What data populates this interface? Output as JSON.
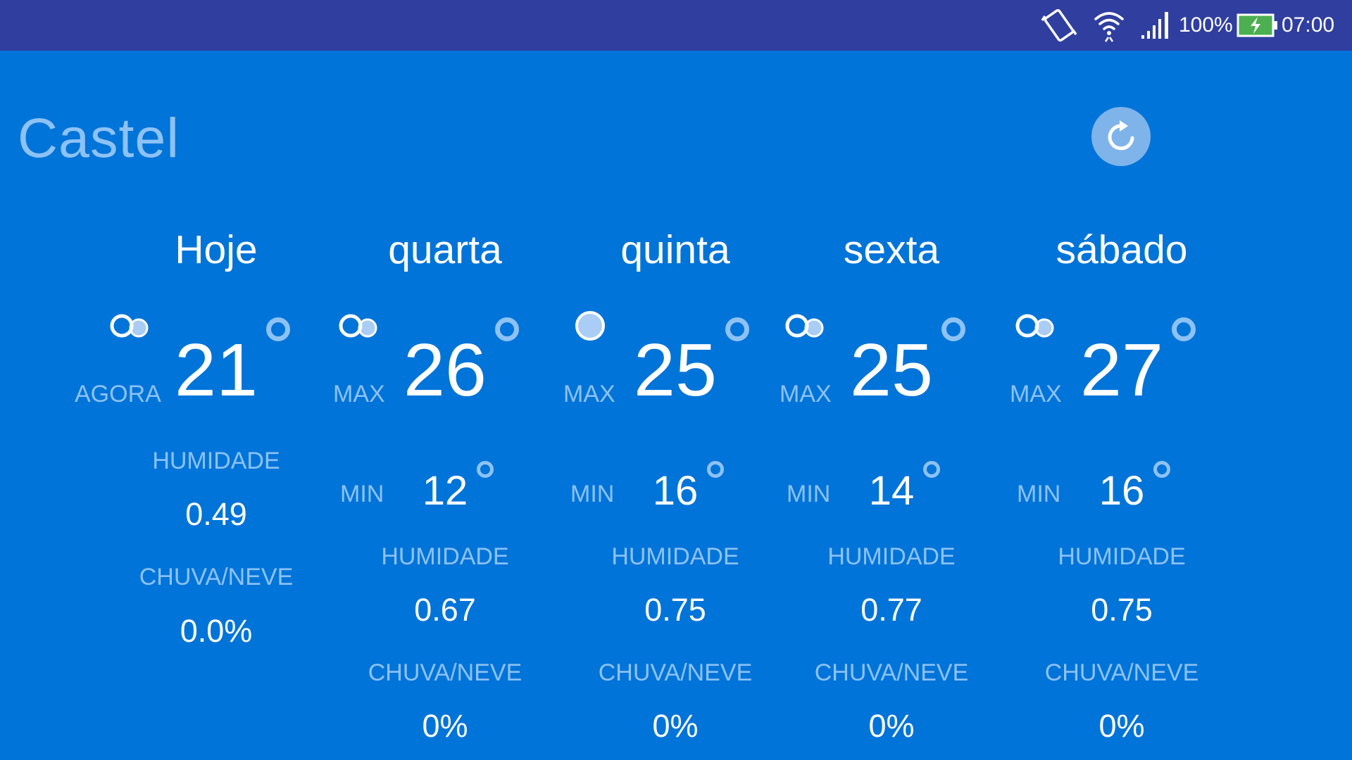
{
  "status_bar": {
    "battery": "100%",
    "time": "07:00",
    "icons": [
      "vibrate-icon",
      "wifi-icon",
      "signal-icon",
      "battery-charging-icon"
    ]
  },
  "location": {
    "city": "Castel"
  },
  "refresh_icon": "refresh-icon",
  "today": {
    "day": "Hoje",
    "icon": "partly-cloudy-icon",
    "label": "AGORA",
    "temp": "21",
    "humidity_label": "HUMIDADE",
    "humidity": "0.49",
    "precip_label": "CHUVA/NEVE",
    "precip": "0.0%"
  },
  "forecast": [
    {
      "day": "quarta",
      "icon": "partly-cloudy-icon",
      "max_label": "MAX",
      "max": "26",
      "min_label": "MIN",
      "min": "12",
      "humidity_label": "HUMIDADE",
      "humidity": "0.67",
      "precip_label": "CHUVA/NEVE",
      "precip": "0%"
    },
    {
      "day": "quinta",
      "icon": "clear-icon",
      "max_label": "MAX",
      "max": "25",
      "min_label": "MIN",
      "min": "16",
      "humidity_label": "HUMIDADE",
      "humidity": "0.75",
      "precip_label": "CHUVA/NEVE",
      "precip": "0%"
    },
    {
      "day": "sexta",
      "icon": "partly-cloudy-icon",
      "max_label": "MAX",
      "max": "25",
      "min_label": "MIN",
      "min": "14",
      "humidity_label": "HUMIDADE",
      "humidity": "0.77",
      "precip_label": "CHUVA/NEVE",
      "precip": "0%"
    },
    {
      "day": "sábado",
      "icon": "partly-cloudy-icon",
      "max_label": "MAX",
      "max": "27",
      "min_label": "MIN",
      "min": "16",
      "humidity_label": "HUMIDADE",
      "humidity": "0.75",
      "precip_label": "CHUVA/NEVE",
      "precip": "0%"
    }
  ],
  "colors": {
    "background": "#0074d8",
    "status_bar": "#303f9f",
    "muted_text": "#8ec2f5",
    "battery_fill": "#4caf50"
  }
}
